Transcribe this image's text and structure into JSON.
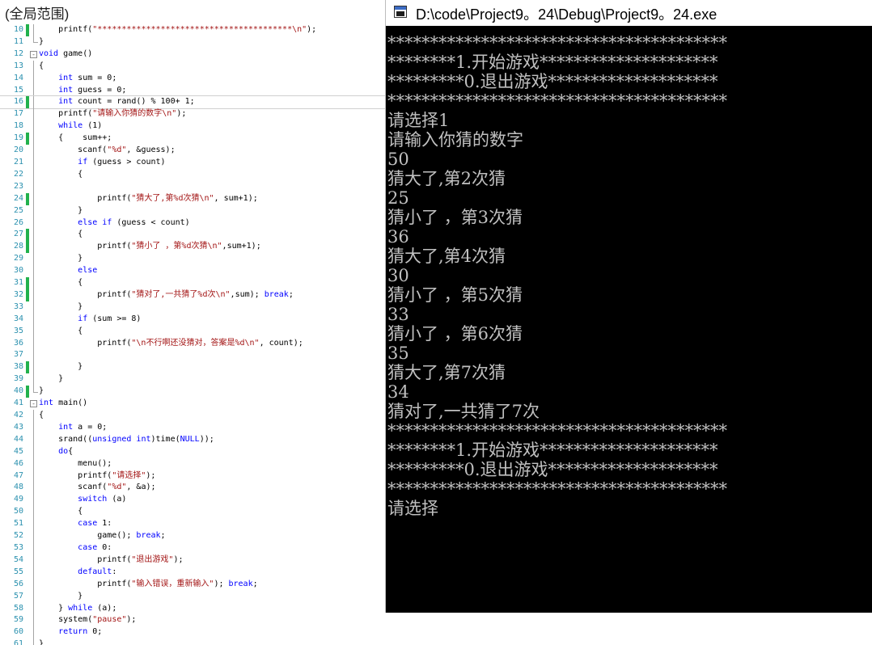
{
  "editor": {
    "scope_label": "(全局范围)",
    "lines": [
      {
        "n": "10",
        "changed": true,
        "fold": "line",
        "t": [
          [
            "    ",
            ""
          ],
          [
            "printf(",
            ""
          ],
          [
            "\"****************************************\\n\"",
            "s"
          ],
          [
            ");",
            ""
          ]
        ]
      },
      {
        "n": "11",
        "changed": false,
        "fold": "end",
        "t": [
          [
            "}",
            ""
          ]
        ]
      },
      {
        "n": "12",
        "changed": false,
        "fold": "box",
        "t": [
          [
            "void",
            "k"
          ],
          [
            " game()",
            ""
          ]
        ]
      },
      {
        "n": "13",
        "changed": false,
        "fold": "line",
        "t": [
          [
            "{",
            ""
          ]
        ]
      },
      {
        "n": "14",
        "changed": false,
        "fold": "line",
        "t": [
          [
            "    ",
            ""
          ],
          [
            "int",
            "k"
          ],
          [
            " sum = 0;",
            ""
          ]
        ]
      },
      {
        "n": "15",
        "changed": false,
        "fold": "line",
        "t": [
          [
            "    ",
            ""
          ],
          [
            "int",
            "k"
          ],
          [
            " guess = 0;",
            ""
          ]
        ]
      },
      {
        "n": "16",
        "changed": true,
        "fold": "line",
        "cur": true,
        "t": [
          [
            "    ",
            ""
          ],
          [
            "int",
            "k"
          ],
          [
            " count = rand() % 100+ 1;",
            ""
          ]
        ]
      },
      {
        "n": "17",
        "changed": false,
        "fold": "line",
        "t": [
          [
            "    printf(",
            ""
          ],
          [
            "\"请输入你猜的数字\\n\"",
            "s"
          ],
          [
            ");",
            ""
          ]
        ]
      },
      {
        "n": "18",
        "changed": false,
        "fold": "line",
        "t": [
          [
            "    ",
            ""
          ],
          [
            "while",
            "k"
          ],
          [
            " (1)",
            ""
          ]
        ]
      },
      {
        "n": "19",
        "changed": true,
        "fold": "line",
        "t": [
          [
            "    {    sum++;",
            ""
          ]
        ]
      },
      {
        "n": "20",
        "changed": false,
        "fold": "line",
        "t": [
          [
            "        scanf(",
            ""
          ],
          [
            "\"%d\"",
            "s"
          ],
          [
            ", &guess);",
            ""
          ]
        ]
      },
      {
        "n": "21",
        "changed": false,
        "fold": "line",
        "t": [
          [
            "        ",
            ""
          ],
          [
            "if",
            "k"
          ],
          [
            " (guess > count)",
            ""
          ]
        ]
      },
      {
        "n": "22",
        "changed": false,
        "fold": "line",
        "t": [
          [
            "        {",
            ""
          ]
        ]
      },
      {
        "n": "23",
        "changed": false,
        "fold": "line",
        "t": [
          [
            "",
            ""
          ]
        ]
      },
      {
        "n": "24",
        "changed": true,
        "fold": "line",
        "t": [
          [
            "            printf(",
            ""
          ],
          [
            "\"猜大了,第%d次猜\\n\"",
            "s"
          ],
          [
            ", sum+1);",
            ""
          ]
        ]
      },
      {
        "n": "25",
        "changed": false,
        "fold": "line",
        "t": [
          [
            "        }",
            ""
          ]
        ]
      },
      {
        "n": "26",
        "changed": false,
        "fold": "line",
        "t": [
          [
            "        ",
            ""
          ],
          [
            "else if",
            "k"
          ],
          [
            " (guess < count)",
            ""
          ]
        ]
      },
      {
        "n": "27",
        "changed": true,
        "fold": "line",
        "t": [
          [
            "        {",
            ""
          ]
        ]
      },
      {
        "n": "28",
        "changed": true,
        "fold": "line",
        "t": [
          [
            "            printf(",
            ""
          ],
          [
            "\"猜小了 ，第%d次猜\\n\"",
            "s"
          ],
          [
            ",sum+1);",
            ""
          ]
        ]
      },
      {
        "n": "29",
        "changed": false,
        "fold": "line",
        "t": [
          [
            "        }",
            ""
          ]
        ]
      },
      {
        "n": "30",
        "changed": false,
        "fold": "line",
        "t": [
          [
            "        ",
            ""
          ],
          [
            "else",
            "k"
          ]
        ]
      },
      {
        "n": "31",
        "changed": true,
        "fold": "line",
        "t": [
          [
            "        {",
            ""
          ]
        ]
      },
      {
        "n": "32",
        "changed": true,
        "fold": "line",
        "t": [
          [
            "            printf(",
            ""
          ],
          [
            "\"猜对了,一共猜了%d次\\n\"",
            "s"
          ],
          [
            ",sum); ",
            ""
          ],
          [
            "break",
            "k"
          ],
          [
            ";",
            ""
          ]
        ]
      },
      {
        "n": "33",
        "changed": false,
        "fold": "line",
        "t": [
          [
            "        }",
            ""
          ]
        ]
      },
      {
        "n": "34",
        "changed": false,
        "fold": "line",
        "t": [
          [
            "        ",
            ""
          ],
          [
            "if",
            "k"
          ],
          [
            " (sum >= 8)",
            ""
          ]
        ]
      },
      {
        "n": "35",
        "changed": false,
        "fold": "line",
        "t": [
          [
            "        {",
            ""
          ]
        ]
      },
      {
        "n": "36",
        "changed": false,
        "fold": "line",
        "t": [
          [
            "            printf(",
            ""
          ],
          [
            "\"\\n不行啊还没猜对，答案是%d\\n\"",
            "s"
          ],
          [
            ", count);",
            ""
          ]
        ]
      },
      {
        "n": "37",
        "changed": false,
        "fold": "line",
        "t": [
          [
            "",
            ""
          ]
        ]
      },
      {
        "n": "38",
        "changed": true,
        "fold": "line",
        "t": [
          [
            "        }",
            ""
          ]
        ]
      },
      {
        "n": "39",
        "changed": false,
        "fold": "line",
        "t": [
          [
            "    }",
            ""
          ]
        ]
      },
      {
        "n": "40",
        "changed": true,
        "fold": "end",
        "t": [
          [
            "}",
            ""
          ]
        ]
      },
      {
        "n": "41",
        "changed": false,
        "fold": "box",
        "t": [
          [
            "int",
            "k"
          ],
          [
            " main()",
            ""
          ]
        ]
      },
      {
        "n": "42",
        "changed": false,
        "fold": "line",
        "t": [
          [
            "{",
            ""
          ]
        ]
      },
      {
        "n": "43",
        "changed": false,
        "fold": "line",
        "t": [
          [
            "    ",
            ""
          ],
          [
            "int",
            "k"
          ],
          [
            " a = 0;",
            ""
          ]
        ]
      },
      {
        "n": "44",
        "changed": false,
        "fold": "line",
        "t": [
          [
            "    srand((",
            ""
          ],
          [
            "unsigned int",
            "k"
          ],
          [
            ")time(",
            ""
          ],
          [
            "NULL",
            "k"
          ],
          [
            "));",
            ""
          ]
        ]
      },
      {
        "n": "45",
        "changed": false,
        "fold": "line",
        "t": [
          [
            "    ",
            ""
          ],
          [
            "do",
            "k"
          ],
          [
            "{",
            ""
          ]
        ]
      },
      {
        "n": "46",
        "changed": false,
        "fold": "line",
        "t": [
          [
            "        menu();",
            ""
          ]
        ]
      },
      {
        "n": "47",
        "changed": false,
        "fold": "line",
        "t": [
          [
            "        printf(",
            ""
          ],
          [
            "\"请选择\"",
            "s"
          ],
          [
            ");",
            ""
          ]
        ]
      },
      {
        "n": "48",
        "changed": false,
        "fold": "line",
        "t": [
          [
            "        scanf(",
            ""
          ],
          [
            "\"%d\"",
            "s"
          ],
          [
            ", &a);",
            ""
          ]
        ]
      },
      {
        "n": "49",
        "changed": false,
        "fold": "line",
        "t": [
          [
            "        ",
            ""
          ],
          [
            "switch",
            "k"
          ],
          [
            " (a)",
            ""
          ]
        ]
      },
      {
        "n": "50",
        "changed": false,
        "fold": "line",
        "t": [
          [
            "        {",
            ""
          ]
        ]
      },
      {
        "n": "51",
        "changed": false,
        "fold": "line",
        "t": [
          [
            "        ",
            ""
          ],
          [
            "case",
            "k"
          ],
          [
            " 1:",
            ""
          ]
        ]
      },
      {
        "n": "52",
        "changed": false,
        "fold": "line",
        "t": [
          [
            "            game(); ",
            ""
          ],
          [
            "break",
            "k"
          ],
          [
            ";",
            ""
          ]
        ]
      },
      {
        "n": "53",
        "changed": false,
        "fold": "line",
        "t": [
          [
            "        ",
            ""
          ],
          [
            "case",
            "k"
          ],
          [
            " 0:",
            ""
          ]
        ]
      },
      {
        "n": "54",
        "changed": false,
        "fold": "line",
        "t": [
          [
            "            printf(",
            ""
          ],
          [
            "\"退出游戏\"",
            "s"
          ],
          [
            ");",
            ""
          ]
        ]
      },
      {
        "n": "55",
        "changed": false,
        "fold": "line",
        "t": [
          [
            "        ",
            ""
          ],
          [
            "default",
            "k"
          ],
          [
            ":",
            ""
          ]
        ]
      },
      {
        "n": "56",
        "changed": false,
        "fold": "line",
        "t": [
          [
            "            printf(",
            ""
          ],
          [
            "\"输入错误，重新输入\"",
            "s"
          ],
          [
            "); ",
            ""
          ],
          [
            "break",
            "k"
          ],
          [
            ";",
            ""
          ]
        ]
      },
      {
        "n": "57",
        "changed": false,
        "fold": "line",
        "t": [
          [
            "        }",
            ""
          ]
        ]
      },
      {
        "n": "58",
        "changed": false,
        "fold": "line",
        "t": [
          [
            "    } ",
            ""
          ],
          [
            "while",
            "k"
          ],
          [
            " (a);",
            ""
          ]
        ]
      },
      {
        "n": "59",
        "changed": false,
        "fold": "line",
        "t": [
          [
            "    system(",
            ""
          ],
          [
            "\"pause\"",
            "s"
          ],
          [
            ");",
            ""
          ]
        ]
      },
      {
        "n": "60",
        "changed": false,
        "fold": "line",
        "t": [
          [
            "    ",
            ""
          ],
          [
            "return",
            "k"
          ],
          [
            " 0;",
            ""
          ]
        ]
      },
      {
        "n": "61",
        "changed": false,
        "fold": "line",
        "t": [
          [
            "}",
            ""
          ]
        ]
      }
    ]
  },
  "console": {
    "title": "D:\\code\\Project9。24\\Debug\\Project9。24.exe",
    "lines": [
      "****************************************",
      "********1.开始游戏*********************",
      "*********0.退出游戏********************",
      "****************************************",
      "请选择1",
      "请输入你猜的数字",
      "50",
      "猜大了,第2次猜",
      "25",
      "猜小了 ，第3次猜",
      "36",
      "猜大了,第4次猜",
      "30",
      "猜小了 ，第5次猜",
      "33",
      "猜小了 ，第6次猜",
      "35",
      "猜大了,第7次猜",
      "34",
      "猜对了,一共猜了7次",
      "****************************************",
      "********1.开始游戏*********************",
      "*********0.退出游戏********************",
      "****************************************",
      "请选择"
    ]
  }
}
